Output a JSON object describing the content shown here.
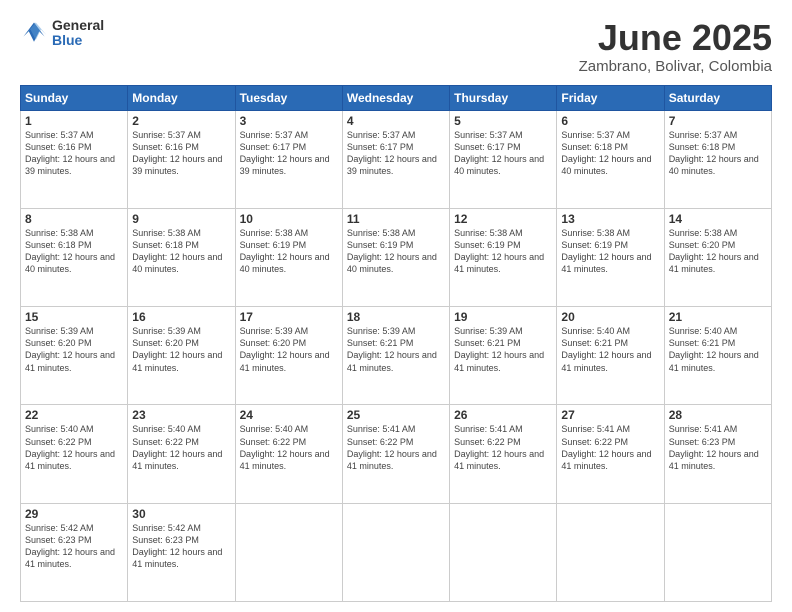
{
  "logo": {
    "general": "General",
    "blue": "Blue"
  },
  "header": {
    "month": "June 2025",
    "location": "Zambrano, Bolivar, Colombia"
  },
  "weekdays": [
    "Sunday",
    "Monday",
    "Tuesday",
    "Wednesday",
    "Thursday",
    "Friday",
    "Saturday"
  ],
  "weeks": [
    [
      {
        "day": "1",
        "sunrise": "5:37 AM",
        "sunset": "6:16 PM",
        "daylight": "12 hours and 39 minutes."
      },
      {
        "day": "2",
        "sunrise": "5:37 AM",
        "sunset": "6:16 PM",
        "daylight": "12 hours and 39 minutes."
      },
      {
        "day": "3",
        "sunrise": "5:37 AM",
        "sunset": "6:17 PM",
        "daylight": "12 hours and 39 minutes."
      },
      {
        "day": "4",
        "sunrise": "5:37 AM",
        "sunset": "6:17 PM",
        "daylight": "12 hours and 39 minutes."
      },
      {
        "day": "5",
        "sunrise": "5:37 AM",
        "sunset": "6:17 PM",
        "daylight": "12 hours and 40 minutes."
      },
      {
        "day": "6",
        "sunrise": "5:37 AM",
        "sunset": "6:18 PM",
        "daylight": "12 hours and 40 minutes."
      },
      {
        "day": "7",
        "sunrise": "5:37 AM",
        "sunset": "6:18 PM",
        "daylight": "12 hours and 40 minutes."
      }
    ],
    [
      {
        "day": "8",
        "sunrise": "5:38 AM",
        "sunset": "6:18 PM",
        "daylight": "12 hours and 40 minutes."
      },
      {
        "day": "9",
        "sunrise": "5:38 AM",
        "sunset": "6:18 PM",
        "daylight": "12 hours and 40 minutes."
      },
      {
        "day": "10",
        "sunrise": "5:38 AM",
        "sunset": "6:19 PM",
        "daylight": "12 hours and 40 minutes."
      },
      {
        "day": "11",
        "sunrise": "5:38 AM",
        "sunset": "6:19 PM",
        "daylight": "12 hours and 40 minutes."
      },
      {
        "day": "12",
        "sunrise": "5:38 AM",
        "sunset": "6:19 PM",
        "daylight": "12 hours and 41 minutes."
      },
      {
        "day": "13",
        "sunrise": "5:38 AM",
        "sunset": "6:19 PM",
        "daylight": "12 hours and 41 minutes."
      },
      {
        "day": "14",
        "sunrise": "5:38 AM",
        "sunset": "6:20 PM",
        "daylight": "12 hours and 41 minutes."
      }
    ],
    [
      {
        "day": "15",
        "sunrise": "5:39 AM",
        "sunset": "6:20 PM",
        "daylight": "12 hours and 41 minutes."
      },
      {
        "day": "16",
        "sunrise": "5:39 AM",
        "sunset": "6:20 PM",
        "daylight": "12 hours and 41 minutes."
      },
      {
        "day": "17",
        "sunrise": "5:39 AM",
        "sunset": "6:20 PM",
        "daylight": "12 hours and 41 minutes."
      },
      {
        "day": "18",
        "sunrise": "5:39 AM",
        "sunset": "6:21 PM",
        "daylight": "12 hours and 41 minutes."
      },
      {
        "day": "19",
        "sunrise": "5:39 AM",
        "sunset": "6:21 PM",
        "daylight": "12 hours and 41 minutes."
      },
      {
        "day": "20",
        "sunrise": "5:40 AM",
        "sunset": "6:21 PM",
        "daylight": "12 hours and 41 minutes."
      },
      {
        "day": "21",
        "sunrise": "5:40 AM",
        "sunset": "6:21 PM",
        "daylight": "12 hours and 41 minutes."
      }
    ],
    [
      {
        "day": "22",
        "sunrise": "5:40 AM",
        "sunset": "6:22 PM",
        "daylight": "12 hours and 41 minutes."
      },
      {
        "day": "23",
        "sunrise": "5:40 AM",
        "sunset": "6:22 PM",
        "daylight": "12 hours and 41 minutes."
      },
      {
        "day": "24",
        "sunrise": "5:40 AM",
        "sunset": "6:22 PM",
        "daylight": "12 hours and 41 minutes."
      },
      {
        "day": "25",
        "sunrise": "5:41 AM",
        "sunset": "6:22 PM",
        "daylight": "12 hours and 41 minutes."
      },
      {
        "day": "26",
        "sunrise": "5:41 AM",
        "sunset": "6:22 PM",
        "daylight": "12 hours and 41 minutes."
      },
      {
        "day": "27",
        "sunrise": "5:41 AM",
        "sunset": "6:22 PM",
        "daylight": "12 hours and 41 minutes."
      },
      {
        "day": "28",
        "sunrise": "5:41 AM",
        "sunset": "6:23 PM",
        "daylight": "12 hours and 41 minutes."
      }
    ],
    [
      {
        "day": "29",
        "sunrise": "5:42 AM",
        "sunset": "6:23 PM",
        "daylight": "12 hours and 41 minutes."
      },
      {
        "day": "30",
        "sunrise": "5:42 AM",
        "sunset": "6:23 PM",
        "daylight": "12 hours and 41 minutes."
      },
      null,
      null,
      null,
      null,
      null
    ]
  ]
}
